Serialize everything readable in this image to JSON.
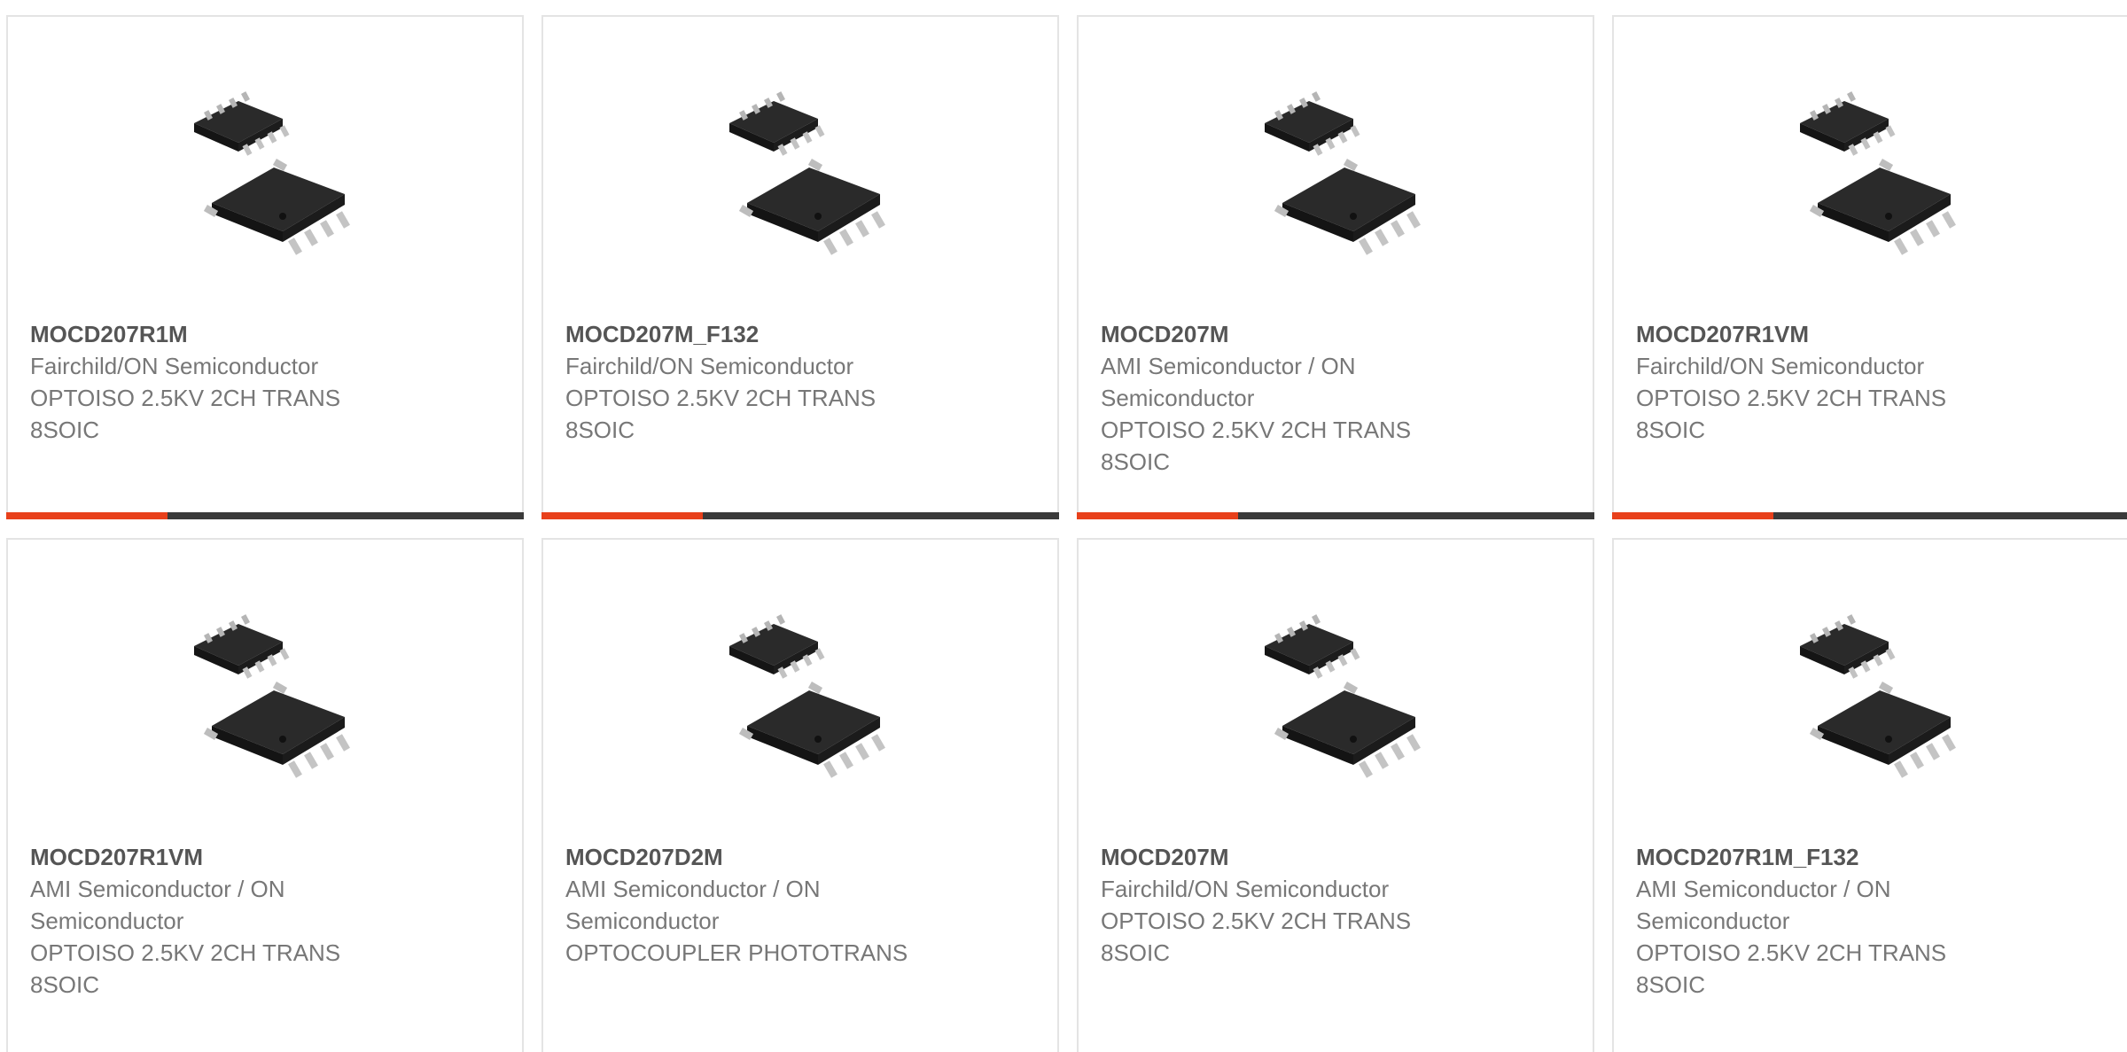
{
  "products": [
    {
      "part_number": "MOCD207R1M",
      "manufacturer": "Fairchild/ON Semiconductor",
      "description": "OPTOISO 2.5KV 2CH TRANS 8SOIC"
    },
    {
      "part_number": "MOCD207M_F132",
      "manufacturer": "Fairchild/ON Semiconductor",
      "description": "OPTOISO 2.5KV 2CH TRANS 8SOIC"
    },
    {
      "part_number": "MOCD207M",
      "manufacturer": "AMI Semiconductor / ON Semiconductor",
      "description": "OPTOISO 2.5KV 2CH TRANS 8SOIC"
    },
    {
      "part_number": "MOCD207R1VM",
      "manufacturer": "Fairchild/ON Semiconductor",
      "description": "OPTOISO 2.5KV 2CH TRANS 8SOIC"
    },
    {
      "part_number": "MOCD207R1VM",
      "manufacturer": "AMI Semiconductor / ON Semiconductor",
      "description": "OPTOISO 2.5KV 2CH TRANS 8SOIC"
    },
    {
      "part_number": "MOCD207D2M",
      "manufacturer": "AMI Semiconductor / ON Semiconductor",
      "description": "OPTOCOUPLER PHOTOTRANS"
    },
    {
      "part_number": "MOCD207M",
      "manufacturer": "Fairchild/ON Semiconductor",
      "description": "OPTOISO 2.5KV 2CH TRANS 8SOIC"
    },
    {
      "part_number": "MOCD207R1M_F132",
      "manufacturer": "AMI Semiconductor / ON Semiconductor",
      "description": "OPTOISO 2.5KV 2CH TRANS 8SOIC"
    }
  ],
  "colors": {
    "accent": "#e8401b",
    "bar": "#3a3a3a",
    "border": "#e4e4e4",
    "text": "#777777",
    "part_number": "#555555"
  },
  "icons": {
    "product_image": "soic-8-chip-icon"
  }
}
